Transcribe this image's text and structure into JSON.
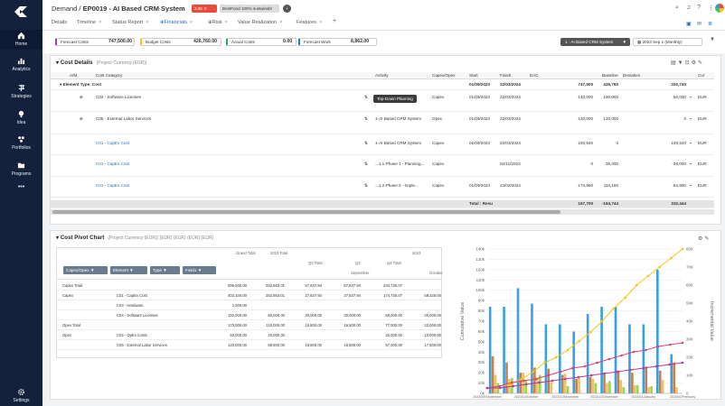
{
  "app": {
    "brand_color": "#14213d",
    "accent": "#1c6fc4"
  },
  "sidebar": {
    "items": [
      {
        "label": "Home",
        "icon": "home-icon"
      },
      {
        "label": "Analytics",
        "icon": "analytics-icon"
      },
      {
        "label": "Strategies",
        "icon": "strategies-icon"
      },
      {
        "label": "Idea",
        "icon": "idea-icon"
      },
      {
        "label": "Portfolios",
        "icon": "portfolios-icon"
      },
      {
        "label": "Programs",
        "icon": "programs-icon"
      }
    ],
    "more": "•••",
    "settings": "Settings"
  },
  "header": {
    "crumb_parent": "Demand /",
    "crumb_title": "EP0019 - AI Based CRM System",
    "status_value": "2.00",
    "status_label": "BestFood 100% sustainabl"
  },
  "tabs": [
    "Details",
    "Timeline",
    "Status Report",
    "Financials",
    "Risk",
    "Value Realization",
    "Features"
  ],
  "kpis": [
    {
      "label": "Forecast Costs",
      "value": "747,500.00"
    },
    {
      "label": "Budget Costs",
      "value": "426,760.00"
    },
    {
      "label": "Actual Costs",
      "value": "0.00"
    },
    {
      "label": "Forecast Work",
      "value": "8,862.00"
    }
  ],
  "toolbar": {
    "project_select": "1 - AI Based CRM System",
    "date_select": "2023 Sep 1 (Monthly)"
  },
  "cost_details": {
    "title": "Cost Details",
    "subtitle": "(Project Currency (EUR))",
    "columns": [
      "A/M",
      "Cost Category",
      "Activity",
      "Capex/Opex",
      "Start",
      "Finish",
      "EAC",
      "Baseline",
      "Deviation",
      "Cur"
    ],
    "group": {
      "label": "Element Type: Cost",
      "start": "01/09/2023",
      "finish": "22/03/2024",
      "eac": "747,500",
      "baseline": "426,760",
      "deviation": "320,740"
    },
    "rows": [
      {
        "category": "C04 - Software Licenses",
        "activity": "",
        "capex": "Capex",
        "start": "01/09/2023",
        "finish": "22/03/2024",
        "eac": "140,000",
        "baseline": "190,000",
        "deviation": "50,000",
        "cur": "EUR"
      },
      {
        "category": "C05 - External Labor Services",
        "activity": "1-AI Based CRM System",
        "capex": "Opex",
        "start": "01/09/2023",
        "finish": "22/03/2024",
        "eac": "120,000",
        "baseline": "120,000",
        "deviation": "0",
        "cur": "EUR"
      },
      {
        "category": "C01 - CapEx Cost",
        "activity": "1-AI Based CRM System",
        "capex": "Capex",
        "start": "01/09/2023",
        "finish": "22/03/2024",
        "eac": "193,540",
        "baseline": "0",
        "deviation": "193,540",
        "cur": "EUR"
      },
      {
        "category": "C01 - CapEx Cost",
        "activity": "...1.1-Phase 1 - Planning...",
        "capex": "Capex",
        "start": "",
        "finish": "02/11/2023",
        "eac": "0",
        "baseline": "36,000",
        "deviation": "-36,000",
        "cur": "EUR"
      },
      {
        "category": "C01 - CapEx Cost",
        "activity": "...1.2-Phase 2 - Imple...",
        "capex": "Capex",
        "start": "01/09/2023",
        "finish": "23/02/2024",
        "eac": "174,960",
        "baseline": "110,160",
        "deviation": "64,800",
        "cur": "EUR"
      }
    ],
    "tooltip": "Top-Down Planning",
    "total": {
      "label": "Total : Resu",
      "eac": "167,700",
      "baseline": "-164,744",
      "deviation": "332,444"
    }
  },
  "pivot": {
    "title": "Cost Pivot Chart",
    "subtitle": "(Project Currency (EUR)) (EUR) (EUR) (EUR) (EUR)",
    "filters": [
      "Capex/Opex",
      "Element",
      "Type",
      "Field1"
    ],
    "col_headers": {
      "grand": "Grand Total",
      "y2023": "2023 Total",
      "year": "2023",
      "q3": "Q3 Total",
      "q3b": "Q3",
      "q4": "Q4 Total",
      "q4b": "Q4",
      "sep": "September",
      "oct": "October"
    },
    "rows": [
      {
        "l1": "Capex Total",
        "l2": "",
        "v": [
          "596,500.00",
          "282,863.01",
          "57,837.94",
          "57,837.94",
          "234,725.07",
          ""
        ]
      },
      {
        "l1": "Capex",
        "l2": "C01 - CapEx Cost",
        "v": [
          "402,100.00",
          "282,863.01",
          "27,837.94",
          "27,837.94",
          "174,725.07",
          "58,325.00"
        ]
      },
      {
        "l1": "",
        "l2": "C03 - Hardware",
        "v": [
          "1,000.00",
          "",
          "",
          "",
          "",
          ""
        ]
      },
      {
        "l1": "",
        "l2": "C04 - Software Licenses",
        "v": [
          "192,000.00",
          "80,000.00",
          "30,000.00",
          "30,000.00",
          "60,000.00",
          "20,000.00"
        ]
      },
      {
        "l1": "Opex Total",
        "l2": "",
        "v": [
          "170,000.00",
          "110,000.00",
          "16,800.00",
          "16,800.00",
          "77,000.00",
          "22,000.00"
        ]
      },
      {
        "l1": "Opex",
        "l2": "C02 - OpEx Costs",
        "v": [
          "50,000.00",
          "20,000.00",
          "",
          "",
          "20,000.00",
          "10,000.00"
        ]
      },
      {
        "l1": "",
        "l2": "C05 - External Labor Services",
        "v": [
          "120,000.00",
          "68,600.00",
          "16,800.00",
          "16,800.00",
          "57,000.00",
          "17,600.00"
        ]
      }
    ]
  },
  "chart_data": {
    "type": "bar",
    "ylabel": "Cumulative Value",
    "y2label": "Incremental Value",
    "ylim": [
      0,
      140
    ],
    "y2lim": [
      0,
      80
    ],
    "yticks": [
      "0k",
      "10k",
      "20k",
      "30k",
      "40k",
      "50k",
      "60k",
      "70k",
      "80k",
      "90k",
      "100k",
      "110k",
      "120k",
      "130k",
      "140k"
    ],
    "y2ticks": [
      "0",
      "10K",
      "20K",
      "30K",
      "40K",
      "50K",
      "60K",
      "70K",
      "80K"
    ],
    "xticks": [
      "2023/09/September",
      "2023/10/October",
      "2023/11/November",
      "2023/12/December",
      "2024/01/January",
      "2024/02/February"
    ],
    "bars": [
      {
        "color": "#3aa0e0",
        "values": [
          84,
          84,
          102,
          87,
          67,
          67,
          60,
          77,
          84,
          84,
          67,
          67,
          120,
          38
        ]
      },
      {
        "color": "#c8804a",
        "values": [
          36,
          30,
          20,
          25,
          24,
          18,
          14,
          16,
          20,
          22,
          20,
          26,
          22,
          30
        ]
      },
      {
        "color": "#e8c46a",
        "values": [
          18,
          14,
          20,
          15,
          11,
          19,
          15,
          14,
          10,
          13,
          8,
          6,
          13,
          6
        ]
      },
      {
        "color": "#9cd54a",
        "values": [
          10,
          15,
          13,
          18,
          0,
          7,
          0,
          10,
          12,
          6,
          8,
          7,
          0,
          0
        ]
      }
    ],
    "lines": [
      {
        "color": "#f5c518",
        "values": [
          3,
          4,
          5,
          8,
          12,
          17,
          20,
          24,
          29,
          34,
          40,
          47,
          53,
          60,
          65,
          70,
          75,
          80
        ]
      },
      {
        "color": "#e0407a",
        "values": [
          3,
          4,
          6,
          7,
          8,
          10,
          12,
          14,
          15,
          17,
          19,
          21,
          23,
          24,
          26,
          27,
          28
        ]
      },
      {
        "color": "#b8379a",
        "values": [
          3,
          3,
          4,
          5,
          6,
          7,
          8,
          9,
          10,
          11,
          12,
          13,
          14,
          15,
          16,
          17
        ]
      }
    ]
  }
}
